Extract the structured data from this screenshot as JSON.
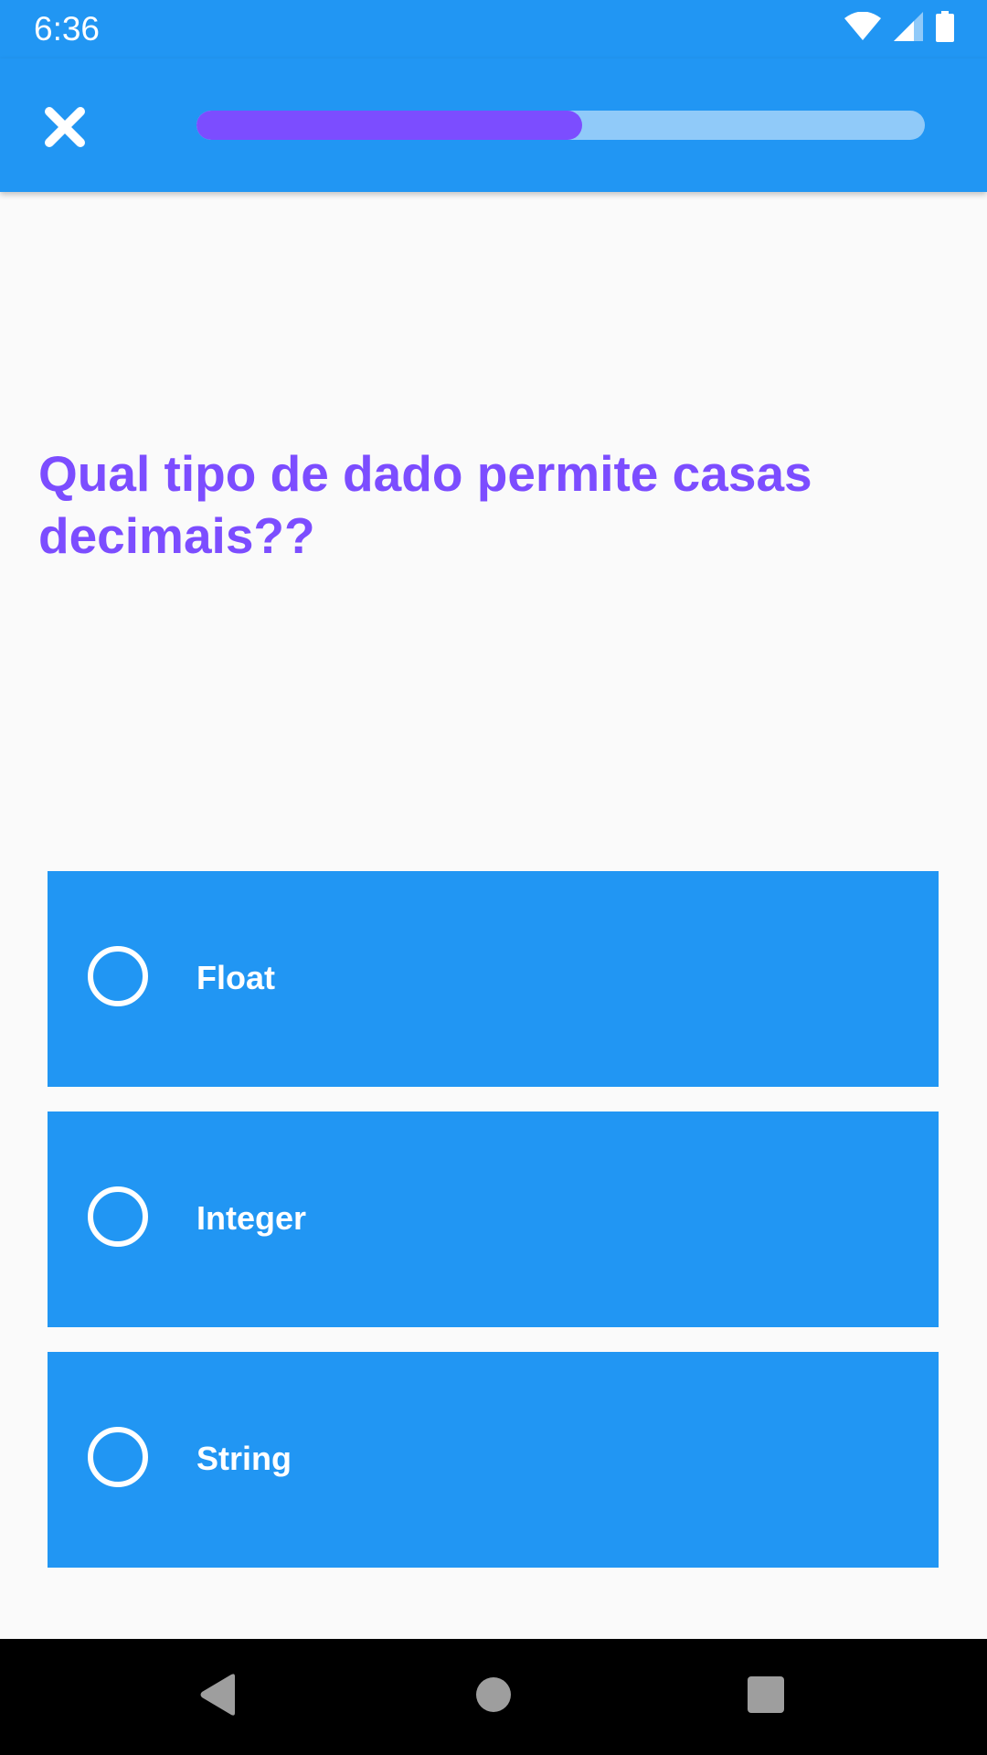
{
  "status_bar": {
    "time": "6:36",
    "icons": [
      "wifi-icon",
      "signal-icon",
      "battery-icon"
    ]
  },
  "app_bar": {
    "close_icon": "close-icon",
    "progress": 0.53
  },
  "quiz": {
    "question": "Qual tipo de dado permite casas decimais??",
    "options": [
      {
        "label": "Float",
        "selected": false
      },
      {
        "label": "Integer",
        "selected": false
      },
      {
        "label": "String",
        "selected": false
      }
    ]
  },
  "nav_bar": {
    "icons": [
      "back-icon",
      "home-icon",
      "recents-icon"
    ]
  },
  "colors": {
    "primary": "#2196f3",
    "accent": "#7c4dff",
    "progress_track": "#90caf9",
    "background": "#fafafa"
  }
}
